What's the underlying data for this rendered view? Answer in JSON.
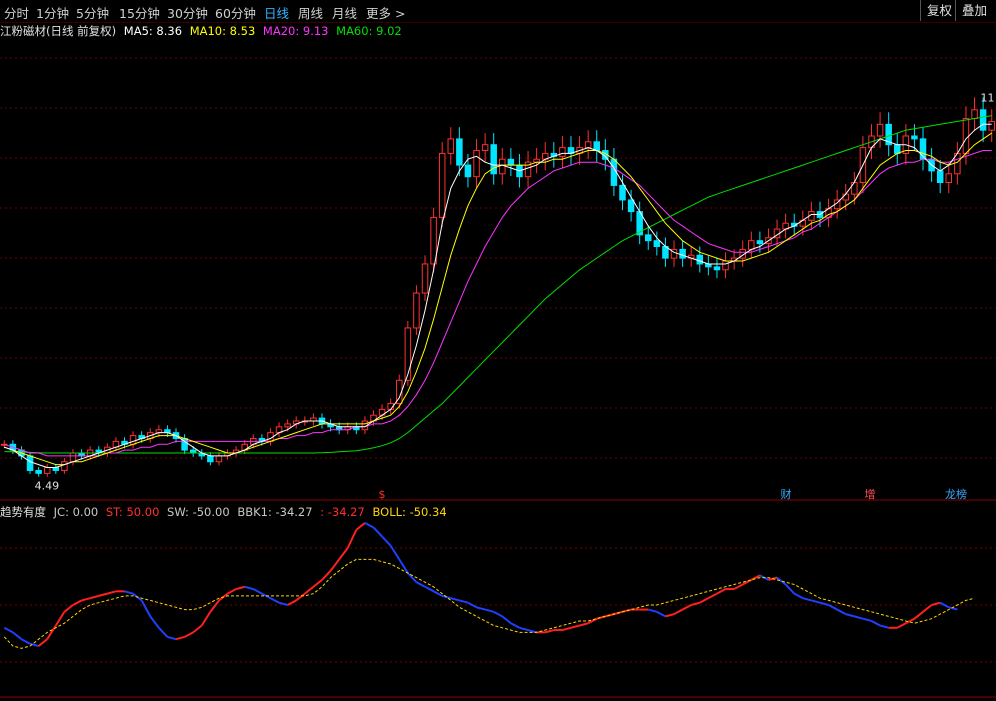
{
  "toolbar": {
    "tabs": [
      "分时",
      "1分钟",
      "5分钟",
      "15分钟",
      "30分钟",
      "60分钟",
      "日线",
      "周线",
      "月线",
      "更多 >"
    ],
    "active_tab": "日线",
    "right_buttons": [
      "复权",
      "叠加"
    ]
  },
  "main_legend": {
    "title": "江粉磁材(日线 前复权)",
    "items": [
      {
        "label": "MA5: 8.36",
        "color": "#ffffff"
      },
      {
        "label": "MA10: 8.53",
        "color": "#ffff00"
      },
      {
        "label": "MA20: 9.13",
        "color": "#ff33ff"
      },
      {
        "label": "MA60: 9.02",
        "color": "#00e000"
      }
    ]
  },
  "price_labels": {
    "low": "4.49",
    "high": "11"
  },
  "event_markers": [
    {
      "label": "$",
      "color": "#ff3030"
    },
    {
      "label": "财",
      "color": "#33aaff"
    },
    {
      "label": "增",
      "color": "#ff5050"
    },
    {
      "label": "龙榜",
      "color": "#33aaff"
    }
  ],
  "indicator_legend": {
    "title": "趋势有度",
    "items": [
      {
        "label": "JC: 0.00",
        "color": "#c8c8c8"
      },
      {
        "label": "ST: 50.00",
        "color": "#ff3030"
      },
      {
        "label": "SW: -50.00",
        "color": "#c8c8c8"
      },
      {
        "label": "BBK1: -34.27",
        "color": "#c8c8c8"
      },
      {
        "label": ": -34.27",
        "color": "#ff3030"
      },
      {
        "label": "BOLL: -50.34",
        "color": "#ffd700"
      }
    ]
  },
  "chart_data": {
    "type": "candlestick",
    "colors": {
      "up": "#ff3030",
      "down": "#00e5ff",
      "ma5": "#ffffff",
      "ma10": "#ffff00",
      "ma20": "#ff33ff",
      "ma60": "#00e000",
      "ind_up": "#ff2020",
      "ind_down": "#2040ff",
      "boll": "#ffd700"
    },
    "closes": [
      5.6,
      5.4,
      5.2,
      4.7,
      4.6,
      4.8,
      4.7,
      5.0,
      5.3,
      5.2,
      5.4,
      5.3,
      5.5,
      5.7,
      5.6,
      5.9,
      5.8,
      6.0,
      6.1,
      6.0,
      5.8,
      5.4,
      5.3,
      5.2,
      5.0,
      5.2,
      5.3,
      5.4,
      5.6,
      5.8,
      5.7,
      6.0,
      6.2,
      6.3,
      6.4,
      6.4,
      6.5,
      6.3,
      6.2,
      6.1,
      6.2,
      6.1,
      6.4,
      6.6,
      6.8,
      7.0,
      7.8,
      9.6,
      10.8,
      11.8,
      13.4,
      15.6,
      16.1,
      15.2,
      14.8,
      15.7,
      15.9,
      14.9,
      15.4,
      15.2,
      14.8,
      15.3,
      15.4,
      15.6,
      15.5,
      15.8,
      15.6,
      15.8,
      16.0,
      15.7,
      15.4,
      14.5,
      14.0,
      13.6,
      12.8,
      12.6,
      12.4,
      12.0,
      12.3,
      12.0,
      12.1,
      11.8,
      11.7,
      11.6,
      11.9,
      12.0,
      12.3,
      12.6,
      12.5,
      12.7,
      13.0,
      13.2,
      13.1,
      13.3,
      13.6,
      13.4,
      13.7,
      14.0,
      14.2,
      14.6,
      15.8,
      16.2,
      16.6,
      15.9,
      15.6,
      16.2,
      16.1,
      15.4,
      15.0,
      14.6,
      14.9,
      15.6,
      16.8,
      17.1,
      16.4,
      16.7
    ],
    "ma5": [
      5.5,
      5.4,
      5.2,
      5.0,
      4.9,
      4.8,
      4.8,
      4.9,
      5.0,
      5.1,
      5.2,
      5.3,
      5.4,
      5.5,
      5.6,
      5.7,
      5.8,
      5.9,
      6.0,
      6.0,
      5.9,
      5.7,
      5.5,
      5.3,
      5.2,
      5.2,
      5.2,
      5.3,
      5.4,
      5.6,
      5.7,
      5.8,
      6.0,
      6.1,
      6.3,
      6.4,
      6.4,
      6.4,
      6.3,
      6.2,
      6.2,
      6.2,
      6.2,
      6.4,
      6.6,
      6.8,
      7.2,
      8.0,
      9.0,
      10.2,
      11.6,
      13.2,
      14.4,
      15.0,
      15.4,
      15.5,
      15.3,
      15.2,
      15.2,
      15.1,
      15.0,
      15.1,
      15.2,
      15.4,
      15.5,
      15.6,
      15.6,
      15.7,
      15.8,
      15.7,
      15.5,
      15.1,
      14.6,
      14.1,
      13.6,
      13.1,
      12.7,
      12.4,
      12.2,
      12.1,
      12.0,
      11.9,
      11.8,
      11.8,
      11.8,
      11.9,
      12.1,
      12.3,
      12.4,
      12.6,
      12.8,
      13.0,
      13.1,
      13.3,
      13.5,
      13.5,
      13.7,
      13.9,
      14.2,
      14.6,
      15.2,
      15.8,
      16.1,
      16.0,
      15.9,
      15.9,
      15.8,
      15.5,
      15.2,
      15.0,
      15.2,
      15.6,
      16.1,
      16.4,
      16.6,
      16.6
    ],
    "ma10": [
      5.5,
      5.4,
      5.3,
      5.2,
      5.1,
      5.0,
      4.9,
      4.9,
      5.0,
      5.0,
      5.1,
      5.2,
      5.3,
      5.4,
      5.5,
      5.6,
      5.7,
      5.8,
      5.9,
      5.9,
      5.9,
      5.8,
      5.7,
      5.6,
      5.5,
      5.4,
      5.3,
      5.3,
      5.4,
      5.5,
      5.6,
      5.7,
      5.8,
      5.9,
      6.0,
      6.1,
      6.2,
      6.3,
      6.3,
      6.3,
      6.3,
      6.3,
      6.3,
      6.4,
      6.5,
      6.6,
      6.9,
      7.4,
      8.1,
      8.9,
      9.9,
      11.0,
      12.1,
      13.0,
      13.8,
      14.4,
      14.9,
      15.1,
      15.2,
      15.2,
      15.2,
      15.2,
      15.3,
      15.3,
      15.4,
      15.4,
      15.5,
      15.6,
      15.7,
      15.7,
      15.6,
      15.4,
      15.1,
      14.8,
      14.4,
      14.0,
      13.6,
      13.2,
      12.9,
      12.6,
      12.4,
      12.2,
      12.1,
      12.0,
      11.9,
      11.9,
      11.9,
      12.0,
      12.1,
      12.2,
      12.4,
      12.6,
      12.8,
      13.0,
      13.2,
      13.3,
      13.5,
      13.6,
      13.8,
      14.0,
      14.4,
      14.8,
      15.2,
      15.4,
      15.6,
      15.7,
      15.7,
      15.6,
      15.5,
      15.3,
      15.2,
      15.3,
      15.6,
      15.9,
      16.1,
      16.3
    ],
    "ma20": [
      5.6,
      5.5,
      5.4,
      5.3,
      5.3,
      5.2,
      5.2,
      5.2,
      5.2,
      5.2,
      5.2,
      5.2,
      5.3,
      5.3,
      5.4,
      5.4,
      5.5,
      5.5,
      5.6,
      5.6,
      5.7,
      5.7,
      5.7,
      5.7,
      5.7,
      5.7,
      5.7,
      5.7,
      5.7,
      5.7,
      5.7,
      5.7,
      5.8,
      5.8,
      5.9,
      5.9,
      6.0,
      6.0,
      6.1,
      6.1,
      6.1,
      6.2,
      6.2,
      6.3,
      6.3,
      6.4,
      6.6,
      6.9,
      7.3,
      7.8,
      8.4,
      9.1,
      9.8,
      10.5,
      11.2,
      11.8,
      12.4,
      12.9,
      13.4,
      13.8,
      14.1,
      14.4,
      14.6,
      14.8,
      15.0,
      15.1,
      15.2,
      15.3,
      15.3,
      15.3,
      15.2,
      15.1,
      14.9,
      14.7,
      14.5,
      14.2,
      13.9,
      13.6,
      13.3,
      13.1,
      12.9,
      12.7,
      12.5,
      12.4,
      12.3,
      12.2,
      12.2,
      12.2,
      12.3,
      12.4,
      12.5,
      12.6,
      12.7,
      12.9,
      13.0,
      13.2,
      13.4,
      13.6,
      13.8,
      14.0,
      14.3,
      14.6,
      14.9,
      15.1,
      15.2,
      15.3,
      15.3,
      15.4,
      15.4,
      15.3,
      15.3,
      15.4,
      15.5,
      15.6,
      15.7,
      15.7
    ],
    "ma60": [
      5.35,
      5.34,
      5.33,
      5.32,
      5.31,
      5.3,
      5.3,
      5.3,
      5.3,
      5.3,
      5.3,
      5.3,
      5.3,
      5.3,
      5.3,
      5.3,
      5.3,
      5.3,
      5.3,
      5.3,
      5.3,
      5.3,
      5.3,
      5.3,
      5.3,
      5.3,
      5.3,
      5.3,
      5.3,
      5.3,
      5.3,
      5.3,
      5.3,
      5.3,
      5.3,
      5.3,
      5.3,
      5.31,
      5.32,
      5.34,
      5.36,
      5.38,
      5.42,
      5.48,
      5.55,
      5.65,
      5.8,
      6.0,
      6.25,
      6.5,
      6.75,
      7.0,
      7.3,
      7.6,
      7.9,
      8.2,
      8.5,
      8.8,
      9.1,
      9.4,
      9.7,
      10.0,
      10.3,
      10.6,
      10.85,
      11.1,
      11.35,
      11.6,
      11.8,
      12.0,
      12.2,
      12.4,
      12.6,
      12.75,
      12.9,
      13.05,
      13.2,
      13.35,
      13.5,
      13.65,
      13.8,
      13.95,
      14.1,
      14.2,
      14.3,
      14.4,
      14.5,
      14.6,
      14.7,
      14.8,
      14.9,
      15.0,
      15.1,
      15.2,
      15.3,
      15.4,
      15.5,
      15.6,
      15.7,
      15.8,
      15.9,
      16.0,
      16.1,
      16.2,
      16.3,
      16.4,
      16.45,
      16.5,
      16.55,
      16.6,
      16.65,
      16.7,
      16.75,
      16.8,
      16.85,
      16.9
    ],
    "price_range": [
      4.2,
      19.5
    ],
    "indicator": {
      "st": [
        -20,
        -24,
        -30,
        -34,
        -36,
        -30,
        -18,
        -6,
        0,
        4,
        6,
        8,
        10,
        12,
        12,
        10,
        4,
        -10,
        -20,
        -28,
        -30,
        -28,
        -24,
        -18,
        -6,
        4,
        10,
        14,
        16,
        14,
        10,
        6,
        2,
        0,
        4,
        10,
        16,
        22,
        30,
        40,
        50,
        66,
        72,
        68,
        60,
        52,
        40,
        28,
        20,
        16,
        12,
        8,
        6,
        4,
        2,
        -2,
        -4,
        -6,
        -10,
        -16,
        -20,
        -22,
        -24,
        -24,
        -22,
        -22,
        -20,
        -18,
        -16,
        -12,
        -10,
        -8,
        -6,
        -4,
        -4,
        -4,
        -6,
        -10,
        -8,
        -4,
        0,
        2,
        6,
        10,
        14,
        14,
        18,
        22,
        26,
        22,
        24,
        18,
        10,
        6,
        4,
        2,
        0,
        -4,
        -8,
        -10,
        -12,
        -14,
        -18,
        -20,
        -20,
        -16,
        -12,
        -6,
        0,
        2,
        -2,
        -4
      ],
      "boll": [
        -28,
        -36,
        -38,
        -36,
        -30,
        -24,
        -20,
        -16,
        -10,
        -4,
        0,
        2,
        4,
        6,
        8,
        8,
        6,
        4,
        2,
        0,
        -2,
        -4,
        -4,
        -2,
        2,
        6,
        8,
        8,
        8,
        8,
        8,
        8,
        8,
        8,
        8,
        8,
        10,
        16,
        24,
        30,
        36,
        40,
        40,
        40,
        38,
        36,
        32,
        28,
        24,
        20,
        16,
        10,
        4,
        -2,
        -6,
        -10,
        -14,
        -18,
        -20,
        -22,
        -24,
        -24,
        -24,
        -22,
        -20,
        -18,
        -16,
        -14,
        -14,
        -12,
        -10,
        -8,
        -6,
        -4,
        -2,
        0,
        0,
        2,
        4,
        6,
        8,
        10,
        12,
        14,
        16,
        18,
        20,
        22,
        24,
        24,
        22,
        20,
        18,
        14,
        10,
        6,
        4,
        2,
        0,
        -2,
        -4,
        -6,
        -8,
        -10,
        -12,
        -14,
        -16,
        -14,
        -12,
        -8,
        -4,
        0,
        4,
        6
      ]
    }
  }
}
